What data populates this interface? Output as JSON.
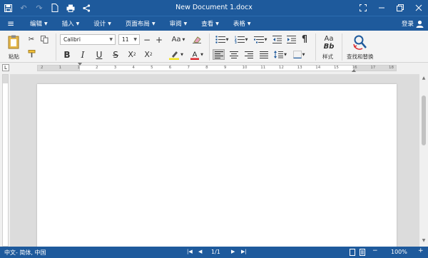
{
  "titlebar": {
    "title": "New Document 1.docx"
  },
  "menu": {
    "items": [
      {
        "label": "编辑"
      },
      {
        "label": "插入"
      },
      {
        "label": "设计"
      },
      {
        "label": "页面布局"
      },
      {
        "label": "审阅"
      },
      {
        "label": "查看"
      },
      {
        "label": "表格"
      }
    ],
    "login_label": "登录"
  },
  "ribbon": {
    "paste_label": "粘贴",
    "font_name": "Calibri",
    "font_size": "11",
    "styles_label": "样式",
    "styles_glyph": "Aa",
    "styles_glyph2": "Bb",
    "find_replace_label": "查找和替换",
    "change_case_label": "Aa",
    "font_color": "#d9262c",
    "highlight_color": "#f2e21c"
  },
  "ruler": {
    "ticks": [
      "2",
      "1",
      "1",
      "2",
      "3",
      "4",
      "5",
      "6",
      "7",
      "8",
      "9",
      "10",
      "11",
      "12",
      "13",
      "14",
      "15",
      "16",
      "17",
      "18"
    ]
  },
  "status": {
    "language": "中文- 简体, 中国",
    "page": "1/1",
    "zoom": "100%"
  }
}
